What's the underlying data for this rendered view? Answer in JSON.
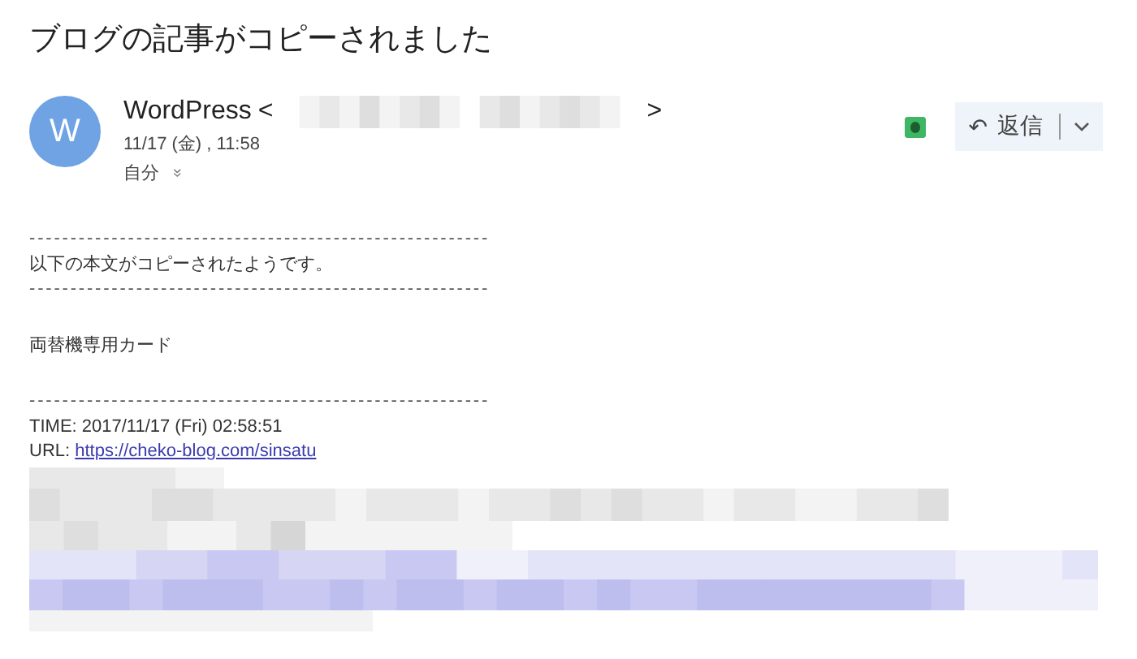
{
  "subject": "ブログの記事がコピーされました",
  "sender": {
    "avatar_letter": "W",
    "name": "WordPress",
    "open_bracket": "<",
    "close_bracket": ">",
    "date": "11/17 (金) , 11:58",
    "recipient": "自分",
    "recipient_toggle": "»"
  },
  "reply_button": {
    "icon": "↶",
    "label": "返信"
  },
  "body": [
    {
      "kind": "rule",
      "text": "--------------------------------------------------------"
    },
    {
      "kind": "text",
      "text": "以下の本文がコピーされたようです。"
    },
    {
      "kind": "rule",
      "text": "--------------------------------------------------------"
    },
    {
      "kind": "gap"
    },
    {
      "kind": "text",
      "text": "両替機専用カード"
    },
    {
      "kind": "gap"
    },
    {
      "kind": "rule",
      "text": "--------------------------------------------------------"
    },
    {
      "kind": "text",
      "text": "TIME: 2017/11/17 (Fri) 02:58:51"
    },
    {
      "kind": "link",
      "label": "URL:",
      "text": "https://cheko-blog.com/sinsatu"
    }
  ]
}
